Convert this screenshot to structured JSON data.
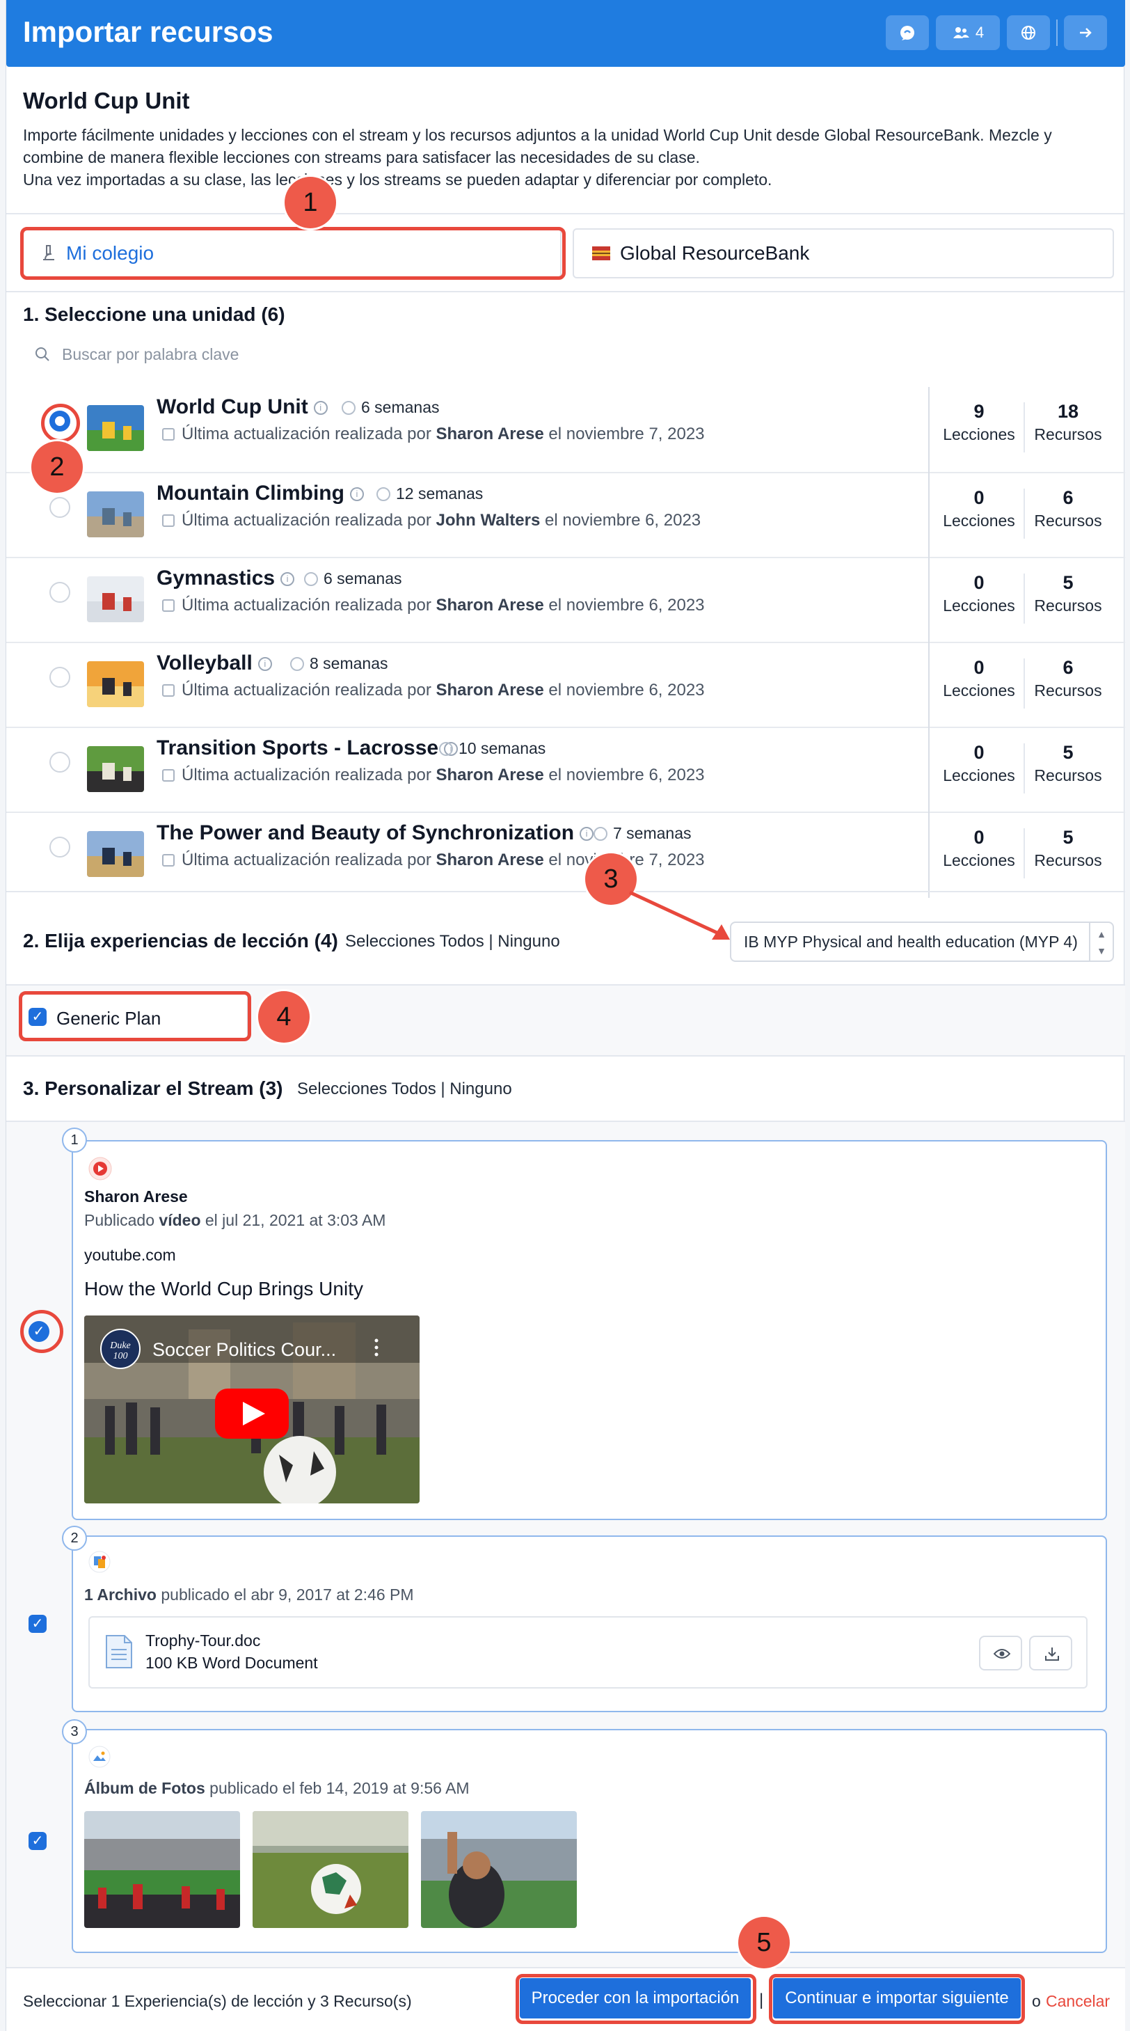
{
  "header": {
    "title": "Importar recursos",
    "members_count": "4"
  },
  "intro": {
    "unit_name": "World Cup Unit",
    "line1": "Importe fácilmente unidades y lecciones con el stream y los recursos adjuntos a la unidad World Cup Unit desde Global ResourceBank. Mezcle y combine de manera flexible lecciones con streams para satisfacer las necesidades de su clase.",
    "line2": "Una vez importadas a su clase, las lecciones y los streams se pueden adaptar y diferenciar por completo."
  },
  "tabs": [
    "Mi colegio",
    "Global ResourceBank"
  ],
  "units_section": {
    "title": "1. Seleccione una unidad (6)",
    "search_placeholder": "Buscar por palabra clave",
    "updated_prefix": "Última actualización realizada por",
    "date_prefix": "el",
    "lessons_label": "Lecciones",
    "resources_label": "Recursos",
    "units": [
      {
        "title": "World Cup Unit",
        "weeks": "6 semanas",
        "author": "Sharon Arese",
        "date": "noviembre 7, 2023",
        "lessons": "9",
        "resources": "18",
        "selected": true
      },
      {
        "title": "Mountain Climbing",
        "weeks": "12 semanas",
        "author": "John Walters",
        "date": "noviembre 6, 2023",
        "lessons": "0",
        "resources": "6",
        "selected": false
      },
      {
        "title": "Gymnastics",
        "weeks": "6 semanas",
        "author": "Sharon Arese",
        "date": "noviembre 6, 2023",
        "lessons": "0",
        "resources": "5",
        "selected": false
      },
      {
        "title": "Volleyball",
        "weeks": "8 semanas",
        "author": "Sharon Arese",
        "date": "noviembre 6, 2023",
        "lessons": "0",
        "resources": "6",
        "selected": false
      },
      {
        "title": "Transition Sports - Lacrosse",
        "weeks": "10 semanas",
        "author": "Sharon Arese",
        "date": "noviembre 6, 2023",
        "lessons": "0",
        "resources": "5",
        "selected": false
      },
      {
        "title": "The Power and Beauty of Synchronization",
        "weeks": "7 semanas",
        "author": "Sharon Arese",
        "date": "noviembre 7, 2023",
        "lessons": "0",
        "resources": "5",
        "selected": false
      }
    ]
  },
  "lessons_section": {
    "title": "2. Elija experiencias de lección (4)",
    "select_all": "Selecciones Todos",
    "separator": "|",
    "none": "Ninguno",
    "dropdown_value": "IB MYP Physical and health education (MYP 4)",
    "option": "Generic Plan"
  },
  "stream_section": {
    "title": "3. Personalizar el Stream (3)",
    "select_all": "Selecciones Todos",
    "separator": "|",
    "none": "Ninguno",
    "items": [
      {
        "num": "1",
        "author": "Sharon Arese",
        "published_prefix": "Publicado",
        "kind": "vídeo",
        "published_suffix": "el jul 21, 2021 at 3:03 AM",
        "source": "youtube.com",
        "title": "How the World Cup Brings Unity",
        "video_title": "Soccer Politics Cour...",
        "channel": "Duke 100"
      },
      {
        "num": "2",
        "kind": "1 Archivo",
        "published_suffix": "publicado el abr 9, 2017 at 2:46 PM",
        "file_name": "Trophy-Tour.doc",
        "file_meta": "100 KB Word Document"
      },
      {
        "num": "3",
        "kind": "Álbum de Fotos",
        "published_suffix": "publicado el feb 14, 2019 at 9:56 AM"
      }
    ]
  },
  "footer": {
    "summary": "Seleccionar 1 Experiencia(s) de lección y 3 Recurso(s)",
    "proceed": "Proceder con la importación",
    "separator": "|",
    "continue": "Continuar e importar siguiente",
    "or": "o",
    "cancel": "Cancelar"
  },
  "annotations": [
    "1",
    "2",
    "3",
    "4",
    "5"
  ],
  "colors": {
    "primary": "#1f7ce0",
    "button": "#1e6fdc",
    "annotation": "#e8483c",
    "cancel": "#e8483c"
  },
  "icons": [
    "chat-icon",
    "people-icon",
    "globe-icon",
    "arrow-right-icon",
    "microscope-icon",
    "flag-icon",
    "search-icon",
    "info-icon",
    "clock-icon",
    "calendar-icon",
    "youtube-icon",
    "document-icon",
    "eye-icon",
    "download-icon",
    "image-icon",
    "check-icon"
  ]
}
